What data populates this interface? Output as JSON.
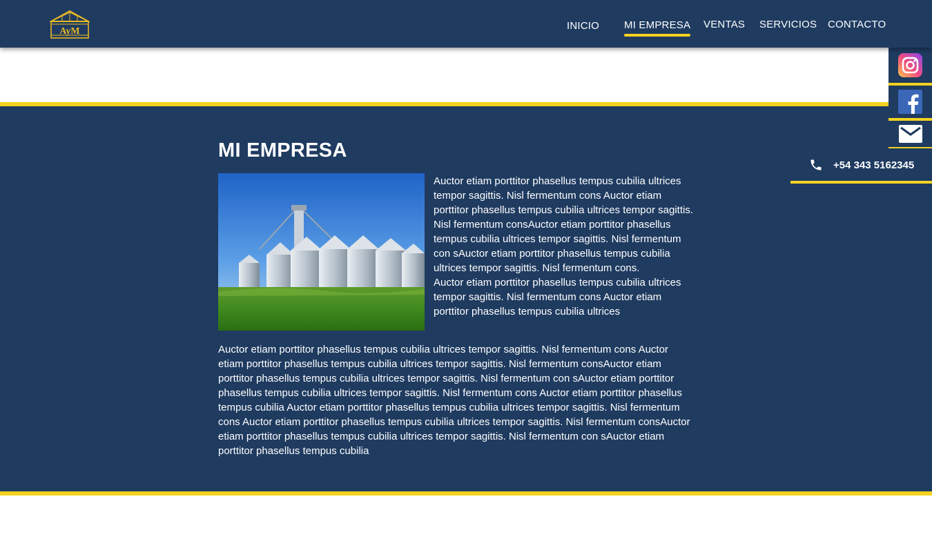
{
  "brand": {
    "logo_text": "AyM"
  },
  "nav": {
    "items": [
      {
        "label": "INICIO"
      },
      {
        "label": "MI EMPRESA"
      },
      {
        "label": "VENTAS"
      },
      {
        "label": "SERVICIOS"
      },
      {
        "label": "CONTACTO"
      }
    ],
    "active_index": 1
  },
  "social": {
    "icons": [
      "instagram-icon",
      "facebook-icon",
      "mail-icon"
    ],
    "phone": "+54 343 5162345"
  },
  "section": {
    "title": "MI EMPRESA",
    "photo_subject": "grain-silos-field",
    "paragraph_1": "Auctor etiam porttitor phasellus tempus cubilia ultrices tempor sagittis. Nisl fermentum cons Auctor etiam porttitor phasellus tempus cubilia ultrices tempor sagittis. Nisl fermentum consAuctor etiam porttitor phasellus tempus cubilia ultrices tempor sagittis. Nisl fermentum con sAuctor etiam porttitor phasellus tempus cubilia ultrices tempor sagittis. Nisl fermentum cons.",
    "paragraph_2": "Auctor etiam porttitor phasellus tempus cubilia ultrices tempor sagittis. Nisl fermentum cons Auctor etiam porttitor phasellus tempus cubilia ultrices",
    "paragraph_3": "Auctor etiam porttitor phasellus tempus cubilia ultrices tempor sagittis. Nisl fermentum cons Auctor etiam porttitor phasellus tempus cubilia ultrices tempor sagittis. Nisl fermentum consAuctor etiam porttitor phasellus tempus cubilia ultrices tempor sagittis. Nisl fermentum con sAuctor etiam porttitor phasellus tempus cubilia ultrices tempor sagittis. Nisl fermentum cons Auctor etiam porttitor phasellus tempus cubilia Auctor etiam porttitor phasellus tempus cubilia ultrices tempor sagittis. Nisl fermentum cons Auctor etiam porttitor phasellus tempus cubilia ultrices tempor sagittis. Nisl fermentum consAuctor etiam porttitor phasellus tempus cubilia ultrices tempor sagittis. Nisl fermentum con sAuctor etiam porttitor phasellus tempus cubilia"
  },
  "colors": {
    "navy": "#1f3b60",
    "accent_yellow": "#f5d21f",
    "text": "#ffffff"
  }
}
